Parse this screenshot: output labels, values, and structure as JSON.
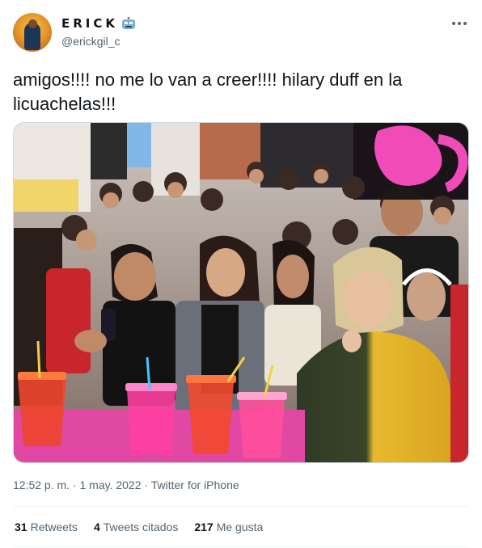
{
  "author": {
    "display_name": "ERICK",
    "handle": "@erickgil_c"
  },
  "tweet": {
    "text": "amigos!!!! no me lo van a creer!!!! hilary duff en la licuachelas!!!"
  },
  "meta": {
    "time": "12:52 p. m.",
    "separator": " · ",
    "date": "1 may. 2022",
    "source": "Twitter for iPhone"
  },
  "stats": {
    "retweets_count": "31",
    "retweets_label": "Retweets",
    "quotes_count": "4",
    "quotes_label": "Tweets citados",
    "likes_count": "217",
    "likes_label": "Me gusta"
  },
  "colors": {
    "text_primary": "#0f1419",
    "text_secondary": "#536471",
    "divider": "#eff3f4",
    "emoji_robot": "#7fb3d5"
  },
  "icons": {
    "name_emoji": "robot-face-icon",
    "more": "more-horizontal-icon"
  }
}
